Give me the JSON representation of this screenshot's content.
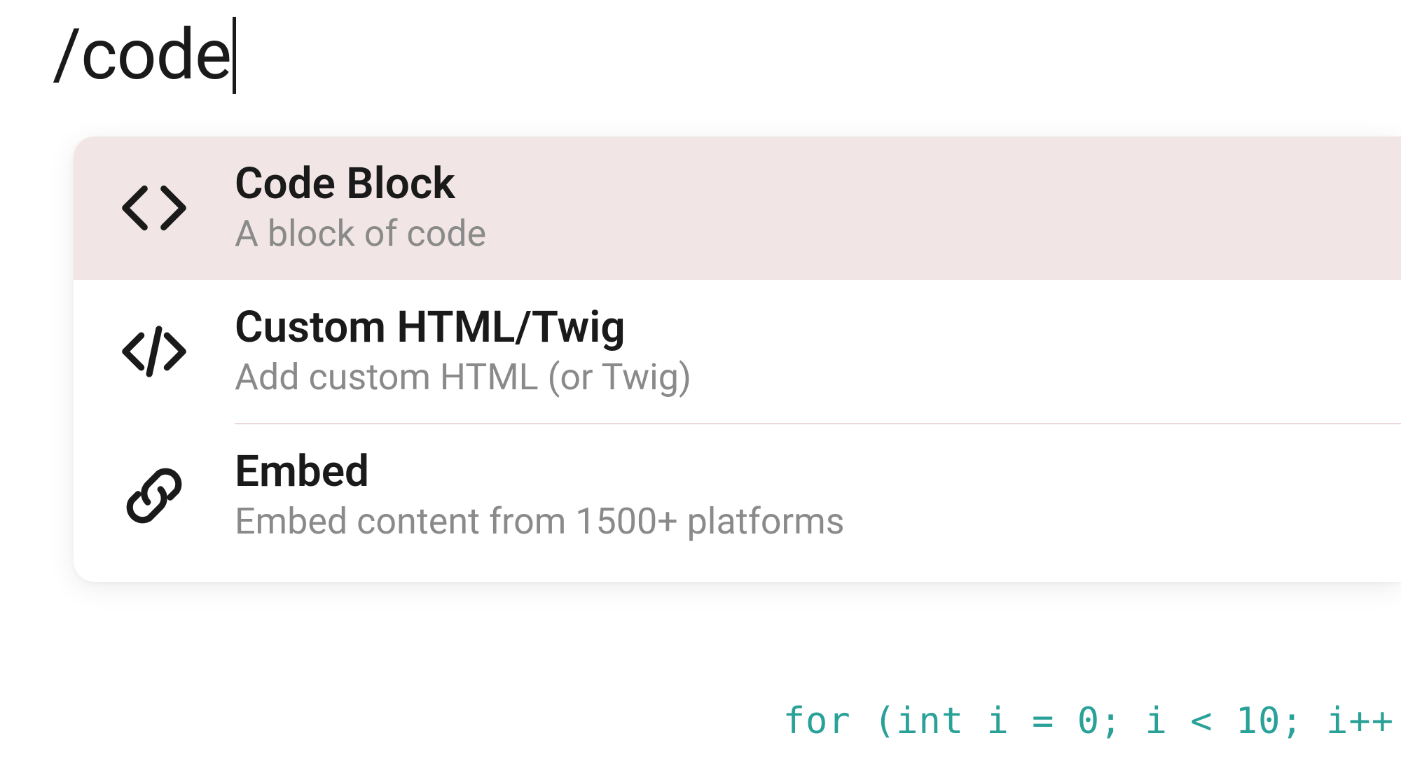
{
  "slash_text": "/code",
  "bg_code_fragment": "for (int i = 0; i < 10; i++",
  "menu": {
    "items": [
      {
        "icon": "angle-brackets-icon",
        "title": "Code Block",
        "desc": "A block of code",
        "selected": true
      },
      {
        "icon": "code-slash-icon",
        "title": "Custom HTML/Twig",
        "desc": "Add custom HTML (or Twig)",
        "selected": false
      },
      {
        "icon": "link-icon",
        "title": "Embed",
        "desc": "Embed content from 1500+ platforms",
        "selected": false
      }
    ]
  }
}
